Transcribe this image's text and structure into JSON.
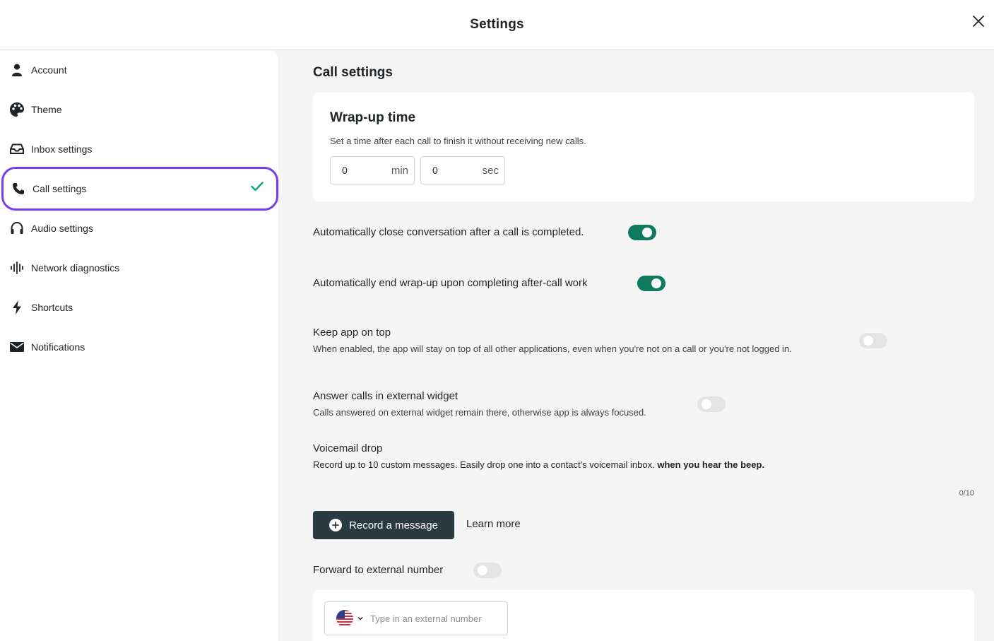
{
  "header": {
    "title": "Settings"
  },
  "sidebar": {
    "items": [
      {
        "label": "Account",
        "icon": "user-icon"
      },
      {
        "label": "Theme",
        "icon": "palette-icon"
      },
      {
        "label": "Inbox settings",
        "icon": "inbox-icon"
      },
      {
        "label": "Call settings",
        "icon": "phone-icon",
        "active": true
      },
      {
        "label": "Audio settings",
        "icon": "headset-icon"
      },
      {
        "label": "Network diagnostics",
        "icon": "waveform-icon"
      },
      {
        "label": "Shortcuts",
        "icon": "lightning-icon"
      },
      {
        "label": "Notifications",
        "icon": "envelope-icon"
      }
    ]
  },
  "main": {
    "section_title": "Call settings",
    "wrap_up": {
      "title": "Wrap-up time",
      "description": "Set a time after each call to finish it without receiving new calls.",
      "minutes": {
        "value": "0",
        "unit": "min"
      },
      "seconds": {
        "value": "0",
        "unit": "sec"
      }
    },
    "auto_close": {
      "label": "Automatically close conversation after a call is completed.",
      "enabled": true
    },
    "auto_end": {
      "label": "Automatically end wrap-up upon completing after-call work",
      "enabled": true
    },
    "keep_on_top": {
      "label": "Keep app on top",
      "description": "When enabled, the app will stay on top of all other applications, even when you're not on a call or you're not logged in.",
      "enabled": false
    },
    "external_widget": {
      "label": "Answer calls in external widget",
      "description": "Calls answered on external widget remain there, otherwise app is always focused.",
      "enabled": false
    },
    "voicemail": {
      "label": "Voicemail drop",
      "description": "Record up to 10 custom messages. Easily drop one into a contact's voicemail inbox.",
      "description_bold": "when you hear the beep.",
      "counter": "0/10",
      "record_label": "Record a message",
      "learn_more": "Learn more"
    },
    "forward": {
      "label": "Forward to external number",
      "enabled": false,
      "placeholder": "Type in an external number"
    }
  },
  "colors": {
    "accent_purple": "#7c3aed",
    "toggle_on": "#0f7a5e",
    "check_green": "#11a37f",
    "button_dark": "#2b3a40"
  }
}
